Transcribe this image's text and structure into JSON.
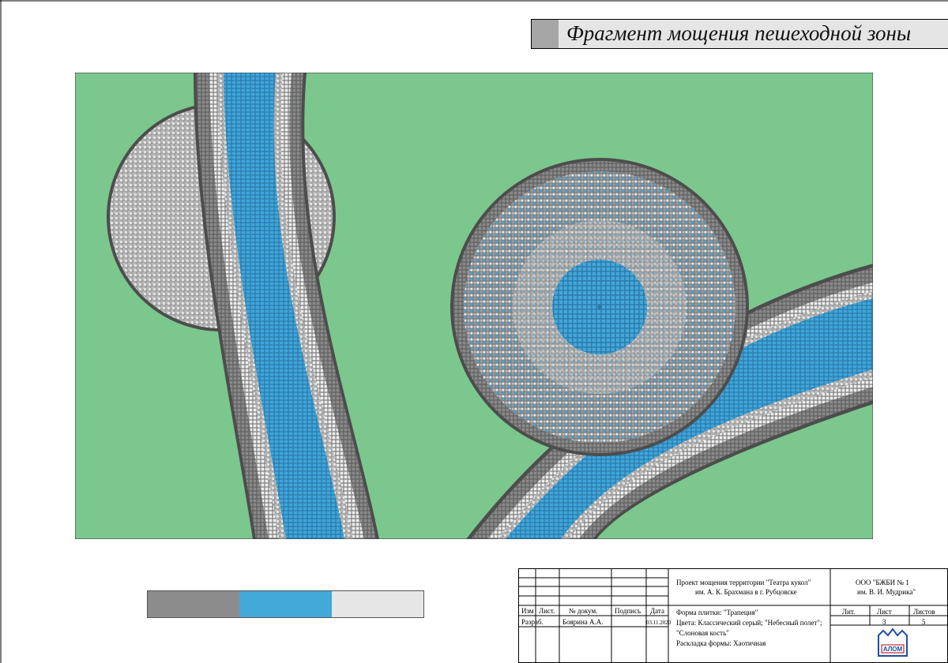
{
  "title": "Фрагмент мощения пешеходной зоны",
  "colors": {
    "grass": "#7bc78e",
    "gray": "#8a8a8a",
    "blue": "#3ba3d9",
    "ivory": "#e8e8e8"
  },
  "swatches": [
    {
      "name": "classic-gray",
      "color": "#8c8c8c"
    },
    {
      "name": "sky-blue",
      "color": "#42a9d8"
    },
    {
      "name": "ivory",
      "color": "#e6e6e6"
    }
  ],
  "stamp": {
    "project": "Проект мощения территории \"Театра кукол\"",
    "project2": "им. А. К. Брахмана в г. Рубцовске",
    "company": "ООО \"БЖБИ № 1",
    "company2": "им. В. И. Мудрика\"",
    "h_izm": "Изм",
    "h_list": "Лист.",
    "h_doc": "№ докум.",
    "h_sign": "Подпись",
    "h_date": "Дата",
    "h_lit": "Лит.",
    "h_sheet": "Лист",
    "h_sheets": "Листов",
    "role": "Разраб.",
    "author": "Боярина А.А.",
    "date": "03.11.2020",
    "sheet": "3",
    "sheets": "5",
    "line1": "Форма плитки: \"Трапеция\"",
    "line2": "Цвета: Классический серый; \"Небесный полет\";",
    "line3": "\"Слоновая кость\"",
    "line4": "Раскладка формы: Хаотичная",
    "logo_text": "АЛОМ"
  }
}
